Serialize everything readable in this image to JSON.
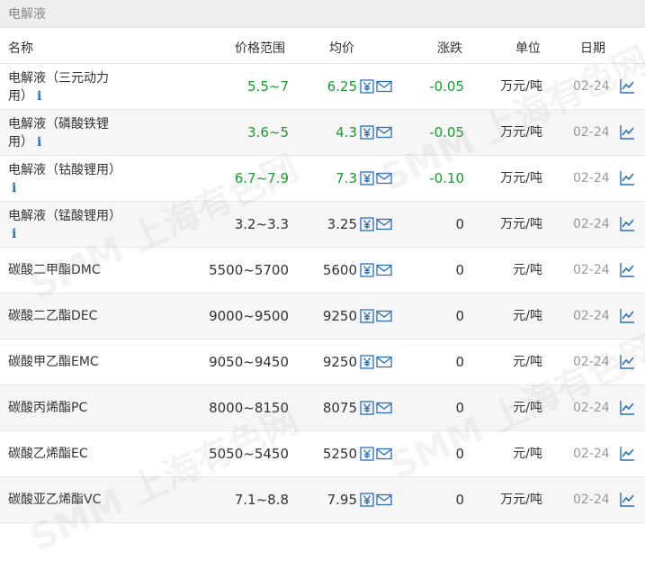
{
  "section": {
    "title": "电解液"
  },
  "header": {
    "name": "名称",
    "range": "价格范围",
    "avg": "均价",
    "change": "涨跌",
    "unit": "单位",
    "date": "日期"
  },
  "rows": [
    {
      "name": "电解液（三元动力用）",
      "line1": "电解液（三元动力",
      "line2": "用）",
      "info": true,
      "range": "5.5~7",
      "avg": "6.25",
      "change": "-0.05",
      "unit": "万元/吨",
      "date": "02-24",
      "trend": "down"
    },
    {
      "name": "电解液（磷酸铁锂用）",
      "line1": "电解液（磷酸铁锂",
      "line2": "用）",
      "info": true,
      "range": "3.6~5",
      "avg": "4.3",
      "change": "-0.05",
      "unit": "万元/吨",
      "date": "02-24",
      "trend": "down"
    },
    {
      "name": "电解液（钴酸锂用）",
      "line1": "电解液（钴酸锂用）",
      "line2": "",
      "info": true,
      "range": "6.7~7.9",
      "avg": "7.3",
      "change": "-0.10",
      "unit": "万元/吨",
      "date": "02-24",
      "trend": "down"
    },
    {
      "name": "电解液（锰酸锂用）",
      "line1": "电解液（锰酸锂用）",
      "line2": "",
      "info": true,
      "range": "3.2~3.3",
      "avg": "3.25",
      "change": "0",
      "unit": "万元/吨",
      "date": "02-24",
      "trend": "flat"
    },
    {
      "name": "碳酸二甲酯DMC",
      "range": "5500~5700",
      "avg": "5600",
      "change": "0",
      "unit": "元/吨",
      "date": "02-24",
      "trend": "flat"
    },
    {
      "name": "碳酸二乙酯DEC",
      "range": "9000~9500",
      "avg": "9250",
      "change": "0",
      "unit": "元/吨",
      "date": "02-24",
      "trend": "flat"
    },
    {
      "name": "碳酸甲乙酯EMC",
      "range": "9050~9450",
      "avg": "9250",
      "change": "0",
      "unit": "元/吨",
      "date": "02-24",
      "trend": "flat"
    },
    {
      "name": "碳酸丙烯酯PC",
      "range": "8000~8150",
      "avg": "8075",
      "change": "0",
      "unit": "元/吨",
      "date": "02-24",
      "trend": "flat"
    },
    {
      "name": "碳酸乙烯酯EC",
      "range": "5050~5450",
      "avg": "5250",
      "change": "0",
      "unit": "元/吨",
      "date": "02-24",
      "trend": "flat"
    },
    {
      "name": "碳酸亚乙烯酯VC",
      "range": "7.1~8.8",
      "avg": "7.95",
      "change": "0",
      "unit": "万元/吨",
      "date": "02-24",
      "trend": "flat"
    }
  ],
  "icons": {
    "currency": "yuan-icon",
    "mail": "mail-icon",
    "chart": "trend-chart-icon",
    "info": "info-icon"
  },
  "colors": {
    "down": "#1a9a2e",
    "flat": "#333333",
    "accent": "#2a6fb5"
  },
  "watermark": "SMM 上海有色网"
}
